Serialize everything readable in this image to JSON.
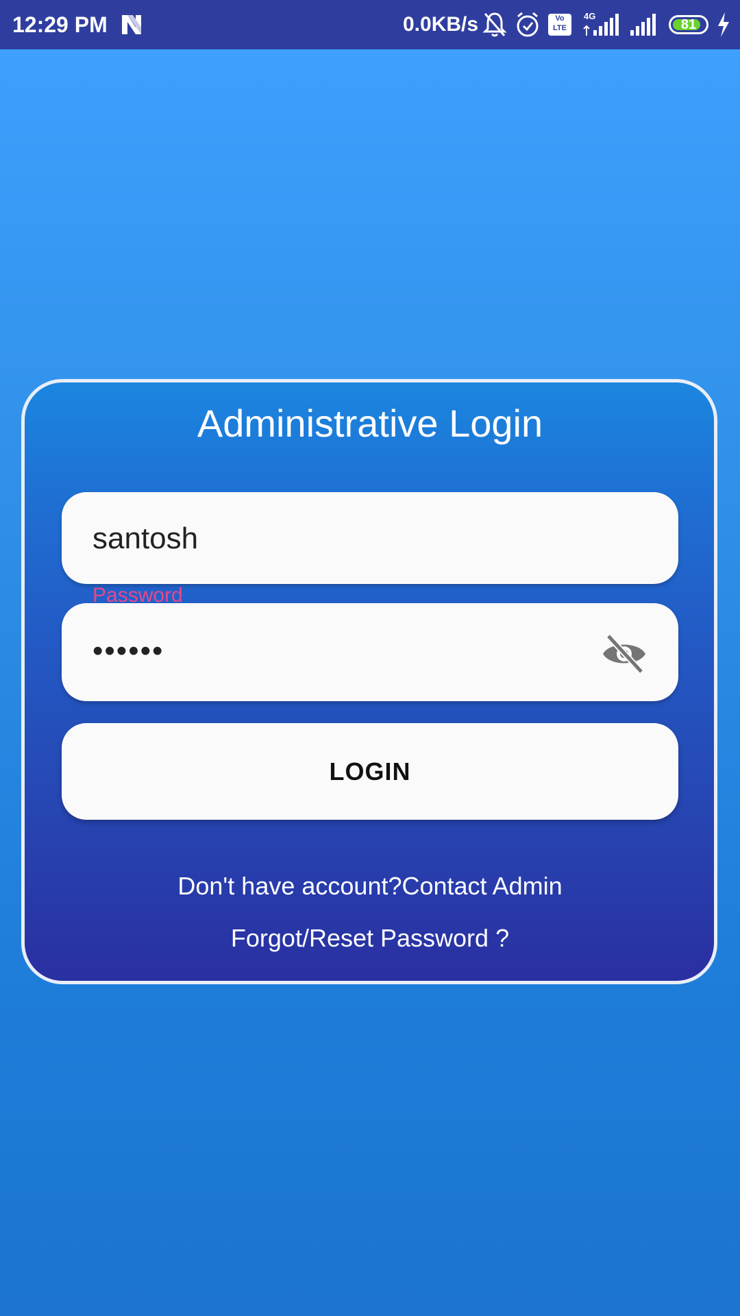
{
  "status_bar": {
    "time": "12:29 PM",
    "network_speed": "0.0KB/s",
    "volte_label_top": "Vo",
    "volte_label_bottom": "LTE",
    "network_type": "4G",
    "battery_level": "81",
    "icons": [
      "n-app-icon",
      "mute-bell-icon",
      "alarm-icon",
      "volte-icon",
      "signal-icon",
      "signal-icon",
      "battery-icon",
      "charging-icon"
    ]
  },
  "login_card": {
    "title": "Administrative Login",
    "username_value": "santosh",
    "password_label": "Password",
    "password_value": "••••••",
    "toggle_icon": "eye-off-icon",
    "login_label": "LOGIN",
    "contact_link": "Don't have account?Contact Admin",
    "forgot_link": "Forgot/Reset Password ?"
  },
  "colors": {
    "status_bar": "#2f3e9e",
    "background_top": "#3ea2ff",
    "background_bottom": "#1c74cf",
    "card_top": "#1b86df",
    "card_bottom": "#2a2fa1",
    "field_bg": "#fafafa",
    "label_accent": "#e8478b"
  }
}
